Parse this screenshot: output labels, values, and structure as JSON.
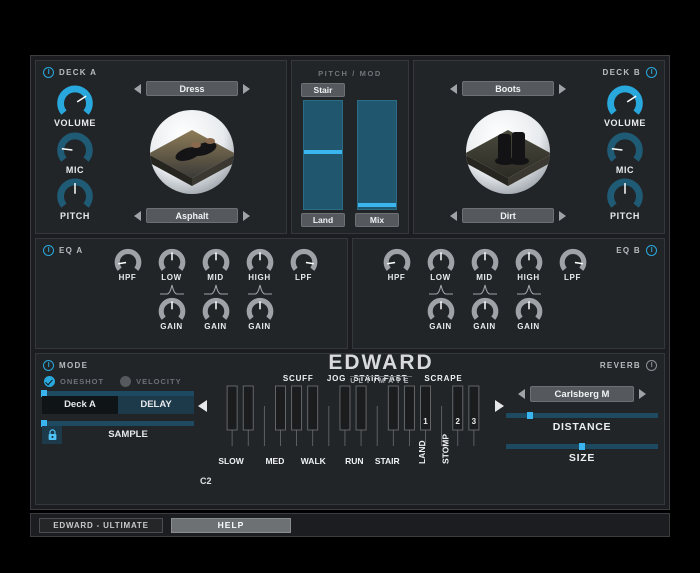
{
  "deck_a": {
    "header": "DECK A",
    "power_icon": "power-icon",
    "preset": "Dress",
    "surface": "Asphalt",
    "artwork_alt": "dress-shoes-on-asphalt",
    "knobs": [
      {
        "label": "VOLUME",
        "value": 72,
        "accent": "#29a8dd"
      },
      {
        "label": "MIC",
        "value": 18,
        "accent": "#1f5b75"
      },
      {
        "label": "PITCH",
        "value": 50,
        "accent": "#1f5b75"
      }
    ]
  },
  "deck_b": {
    "header": "DECK B",
    "power_icon": "power-icon",
    "preset": "Boots",
    "surface": "Dirt",
    "artwork_alt": "boots-on-dirt",
    "knobs": [
      {
        "label": "VOLUME",
        "value": 72,
        "accent": "#29a8dd"
      },
      {
        "label": "MIC",
        "value": 18,
        "accent": "#1f5b75"
      },
      {
        "label": "PITCH",
        "value": 50,
        "accent": "#1f5b75"
      }
    ]
  },
  "pitch_mod": {
    "title": "PITCH / MOD",
    "top_button": "Stair",
    "lanes": [
      {
        "button": "Land",
        "value": 55
      },
      {
        "button": "Mix",
        "value": 6
      }
    ]
  },
  "logo": {
    "main": "EDWARD",
    "sub": "ULTIMATE"
  },
  "eq_a": {
    "header": "EQ  A",
    "power_icon": "power-icon",
    "top_knobs": [
      {
        "label": "HPF",
        "value": 12
      },
      {
        "label": "LOW",
        "value": 50
      },
      {
        "label": "MID",
        "value": 50
      },
      {
        "label": "HIGH",
        "value": 50
      },
      {
        "label": "LPF",
        "value": 88
      }
    ],
    "gain_knobs": [
      {
        "label": "GAIN",
        "value": 50,
        "icon": "bell-curve-icon"
      },
      {
        "label": "GAIN",
        "value": 50,
        "icon": "bell-curve-icon"
      },
      {
        "label": "GAIN",
        "value": 50,
        "icon": "bell-curve-icon"
      }
    ]
  },
  "eq_b": {
    "header": "EQ  B",
    "power_icon": "power-icon",
    "top_knobs": [
      {
        "label": "HPF",
        "value": 12
      },
      {
        "label": "LOW",
        "value": 50
      },
      {
        "label": "MID",
        "value": 50
      },
      {
        "label": "HIGH",
        "value": 50
      },
      {
        "label": "LPF",
        "value": 88
      }
    ],
    "gain_knobs": [
      {
        "label": "GAIN",
        "value": 50,
        "icon": "bell-curve-icon"
      },
      {
        "label": "GAIN",
        "value": 50,
        "icon": "bell-curve-icon"
      },
      {
        "label": "GAIN",
        "value": 50,
        "icon": "bell-curve-icon"
      }
    ]
  },
  "mode": {
    "header": "MODE",
    "power_icon": "power-icon",
    "oneshot": {
      "label": "ONESHOT",
      "checked": true
    },
    "velocity": {
      "label": "VELOCITY",
      "checked": false
    },
    "deck_tab": "Deck A",
    "delay_tab": "DELAY",
    "delay_slider": 1,
    "sample_label": "SAMPLE",
    "sample_slider": 1,
    "lock_icon": "lock-icon",
    "note": "C2",
    "prev_icon": "triangle-left-icon",
    "next_icon": "triangle-right-icon"
  },
  "keyboard": {
    "top_labels": [
      "SCUFF",
      "JOG",
      "STAIR FAST",
      "SCRAPE"
    ],
    "bottom_labels": [
      "SLOW",
      "MED",
      "WALK",
      "RUN",
      "STAIR"
    ],
    "rotated_labels": [
      "LAND",
      "STOMP"
    ],
    "scrape_numbers": [
      "1",
      "2",
      "3"
    ]
  },
  "reverb": {
    "header": "REVERB",
    "power_icon": "power-icon",
    "preset": "Carlsberg M",
    "distance": {
      "label": "DISTANCE",
      "value": 16
    },
    "size": {
      "label": "SIZE",
      "value": 50
    }
  },
  "bottom_bar": {
    "name": "EDWARD - ULTIMATE",
    "help": "HELP"
  },
  "colors": {
    "accent": "#29a8dd",
    "teal": "#20566e",
    "panel": "#222528",
    "frame": "#1b1d20"
  }
}
